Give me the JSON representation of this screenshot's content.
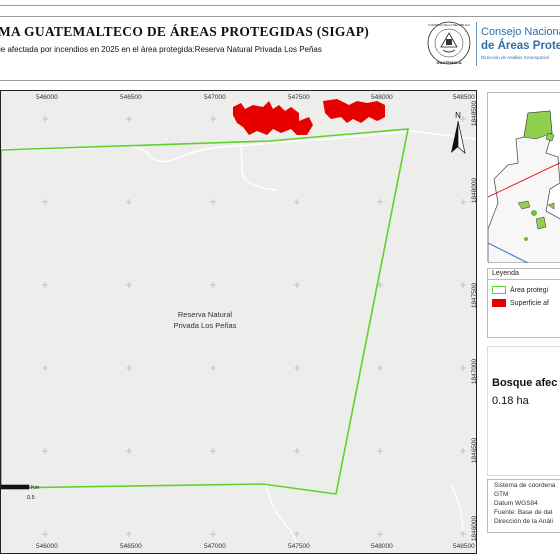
{
  "header": {
    "title": "MA GUATEMALTECO DE ÁREAS PROTEGIDAS  (SIGAP)",
    "subtitle": "ie afectada por incendios en 2025 en el área protegida:Reserva Natural Privada Los Peñas",
    "org_line1": "Consejo Nacional",
    "org_line2": "de Áreas Protegi",
    "org_line3": "Dirección de Análisis Geoespacial",
    "seal_top_text": "CONSEJO DE LA REPÚBLICA",
    "seal_bottom_text": "GUATEMALA"
  },
  "map": {
    "area_label_line1": "Reserva Natural",
    "area_label_line2": "Privada Los Peñas",
    "north_label": "N",
    "x_ticks": [
      "546000",
      "546500",
      "547000",
      "547500",
      "548000",
      "548500"
    ],
    "y_ticks": [
      "1848500",
      "1848000",
      "1847500",
      "1847000",
      "1846500",
      "1846000"
    ],
    "scale_unit": "Km",
    "scale_value": "0.5",
    "colors": {
      "protected_area_outline": "#5fd22e",
      "burned_area": "#e60000",
      "map_background": "#ededeb"
    }
  },
  "legend": {
    "title": "Leyenda",
    "items": [
      {
        "label": "Área protegi",
        "swatch_color": "#5fd22e"
      },
      {
        "label": "Superficie af",
        "swatch_color": "#e60000"
      }
    ]
  },
  "stats": {
    "title": "Bosque afec",
    "value": "0.18 ha"
  },
  "metadata": {
    "lines": [
      "Sistema de coordena",
      "GTM",
      "Datum WGS84",
      "Fuente: Base de dat",
      "Dirección de la Análi"
    ]
  }
}
